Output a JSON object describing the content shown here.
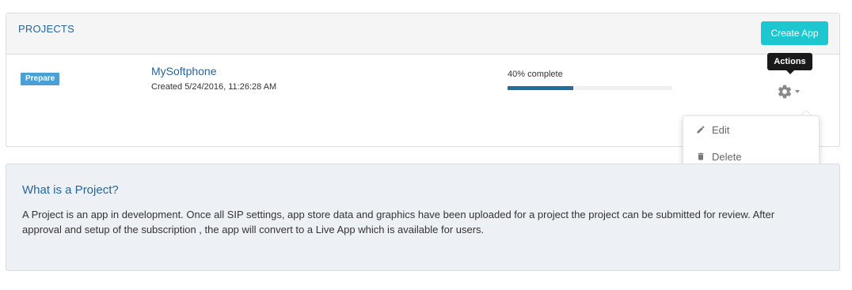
{
  "projects_panel": {
    "title": "PROJECTS",
    "create_button_label": "Create App"
  },
  "project": {
    "status_badge": "Prepare",
    "status_color": "#4a9fd4",
    "name": "MySoftphone",
    "created": "Created 5/24/2016, 11:26:28 AM",
    "progress_label": "40% complete",
    "progress_fraction": 0.4
  },
  "actions": {
    "tooltip": "Actions",
    "gear_icon": "gear-icon",
    "menu_items": [
      {
        "label": "Edit",
        "icon": "pencil-icon"
      },
      {
        "label": "Delete",
        "icon": "trash-icon"
      }
    ]
  },
  "info": {
    "title": "What is a Project?",
    "text": "A Project is an app in development. Once all SIP settings, app store data and graphics have been uploaded for a project the project can be submitted for review. After approval and setup of the subscription , the app will convert to a Live App which is available for users."
  },
  "colors": {
    "accent": "#1cc7d0",
    "link": "#2a6496",
    "progress": "#1f6f9a"
  }
}
